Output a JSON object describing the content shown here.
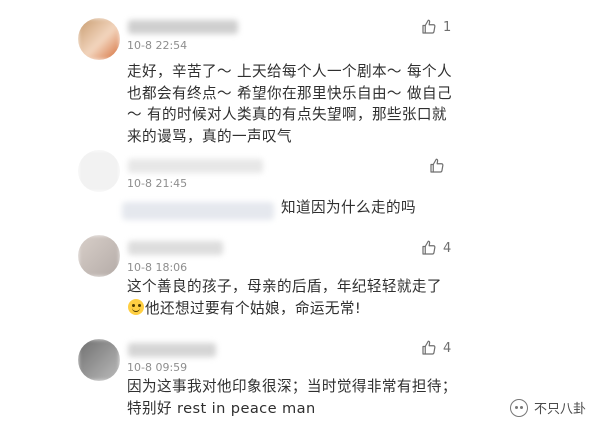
{
  "comments": [
    {
      "timestamp": "10-8 22:54",
      "likes": "1",
      "text": "走好，辛苦了～ 上天给每个人一个剧本～ 每个人也都会有终点～ 希望你在那里快乐自由～ 做自己～ 有的时候对人类真的有点失望啊，那些张口就来的谩骂，真的一声叹气"
    },
    {
      "timestamp": "10-8 21:45",
      "likes": "",
      "text": "知道因为什么走的吗"
    },
    {
      "timestamp": "10-8 18:06",
      "likes": "4",
      "text_before_emoji": "这个善良的孩子，母亲的后盾，年纪轻轻就走了",
      "text_after_emoji": "他还想过要有个姑娘，命运无常!"
    },
    {
      "timestamp": "10-8 09:59",
      "likes": "4",
      "text": "因为这事我对他印象很深；当时觉得非常有担待；  特别好 rest in peace man"
    }
  ],
  "watermark": {
    "text": "不只八卦"
  },
  "colors": {
    "text": "#2f2f2f",
    "meta": "#8e8e8e",
    "icon": "#6f6f6f"
  }
}
